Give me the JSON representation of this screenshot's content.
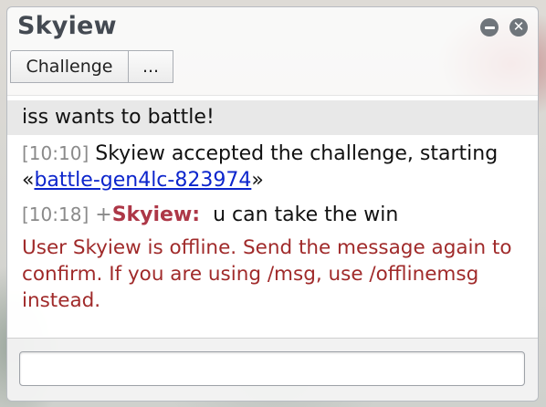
{
  "window": {
    "title": "Skyiew",
    "minimize_icon": "minimize-icon",
    "close_icon": "close-icon"
  },
  "tabs": {
    "challenge_label": "Challenge",
    "more_label": "..."
  },
  "chat": {
    "notice": "iss wants to battle!",
    "messages": [
      {
        "timestamp": "[10:10]",
        "text_before": " Skyiew accepted the challenge, starting «",
        "link_text": "battle-gen4lc-823974",
        "text_after": "»"
      },
      {
        "timestamp": "[10:18]",
        "rank": " +",
        "username": "Skyiew:",
        "text": "  u can take the win"
      }
    ],
    "error": "User Skyiew is offline. Send the message again to confirm. If you are using /msg, use /offlinemsg instead."
  },
  "input": {
    "value": "",
    "placeholder": ""
  },
  "colors": {
    "username": "#ad3747",
    "error": "#a02a2a",
    "link": "#0c25cc",
    "timestamp": "#8a8a8a"
  }
}
